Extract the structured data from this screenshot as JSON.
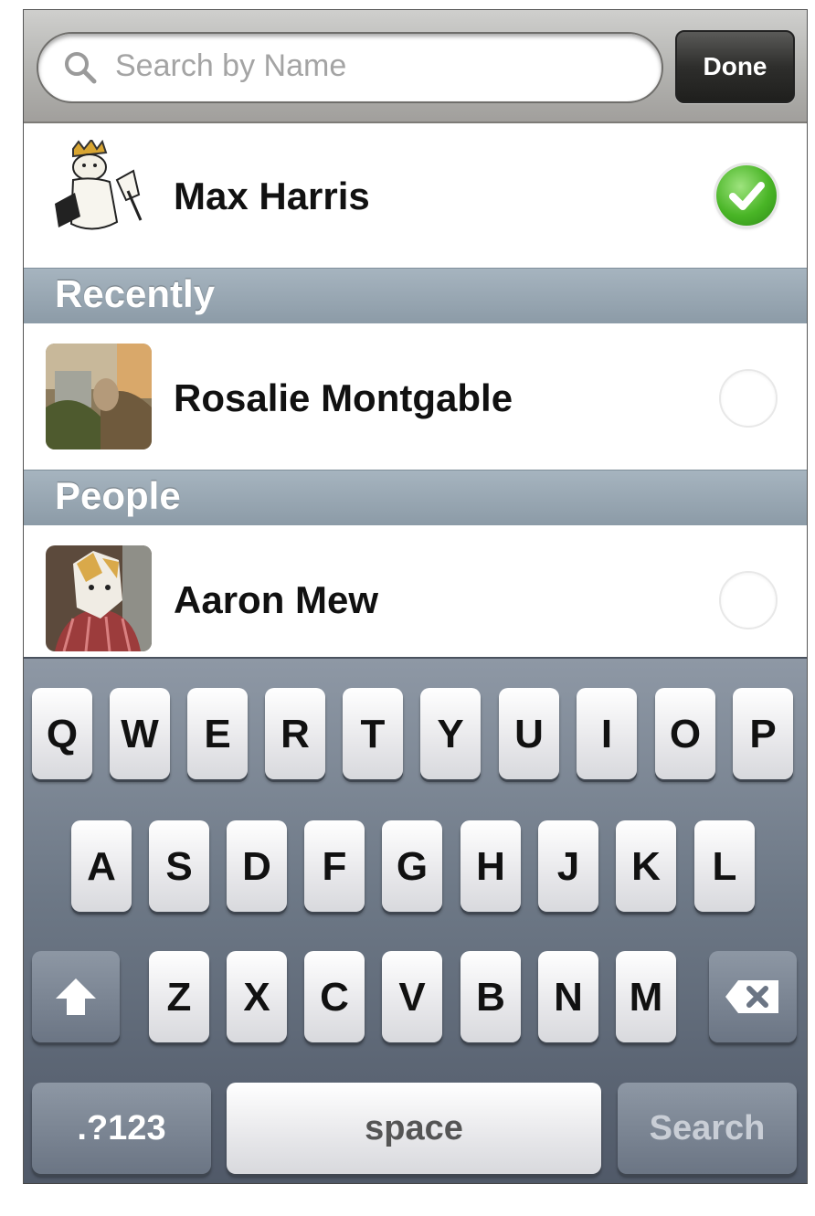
{
  "search": {
    "placeholder": "Search by Name",
    "done_label": "Done"
  },
  "selected_contact": {
    "name": "Max Harris",
    "checked": true
  },
  "sections": [
    {
      "header": "Recently",
      "items": [
        {
          "name": "Rosalie Montgable",
          "checked": false
        }
      ]
    },
    {
      "header": "People",
      "items": [
        {
          "name": "Aaron Mew",
          "checked": false
        }
      ]
    }
  ],
  "keyboard": {
    "row1": [
      "Q",
      "W",
      "E",
      "R",
      "T",
      "Y",
      "U",
      "I",
      "O",
      "P"
    ],
    "row2": [
      "A",
      "S",
      "D",
      "F",
      "G",
      "H",
      "J",
      "K",
      "L"
    ],
    "row3": [
      "Z",
      "X",
      "C",
      "V",
      "B",
      "N",
      "M"
    ],
    "numbers_label": ".?123",
    "space_label": "space",
    "search_label": "Search"
  },
  "colors": {
    "check_green": "#49b526",
    "section_header": "#8c9ba7",
    "keyboard_bg": "#6d7886"
  }
}
